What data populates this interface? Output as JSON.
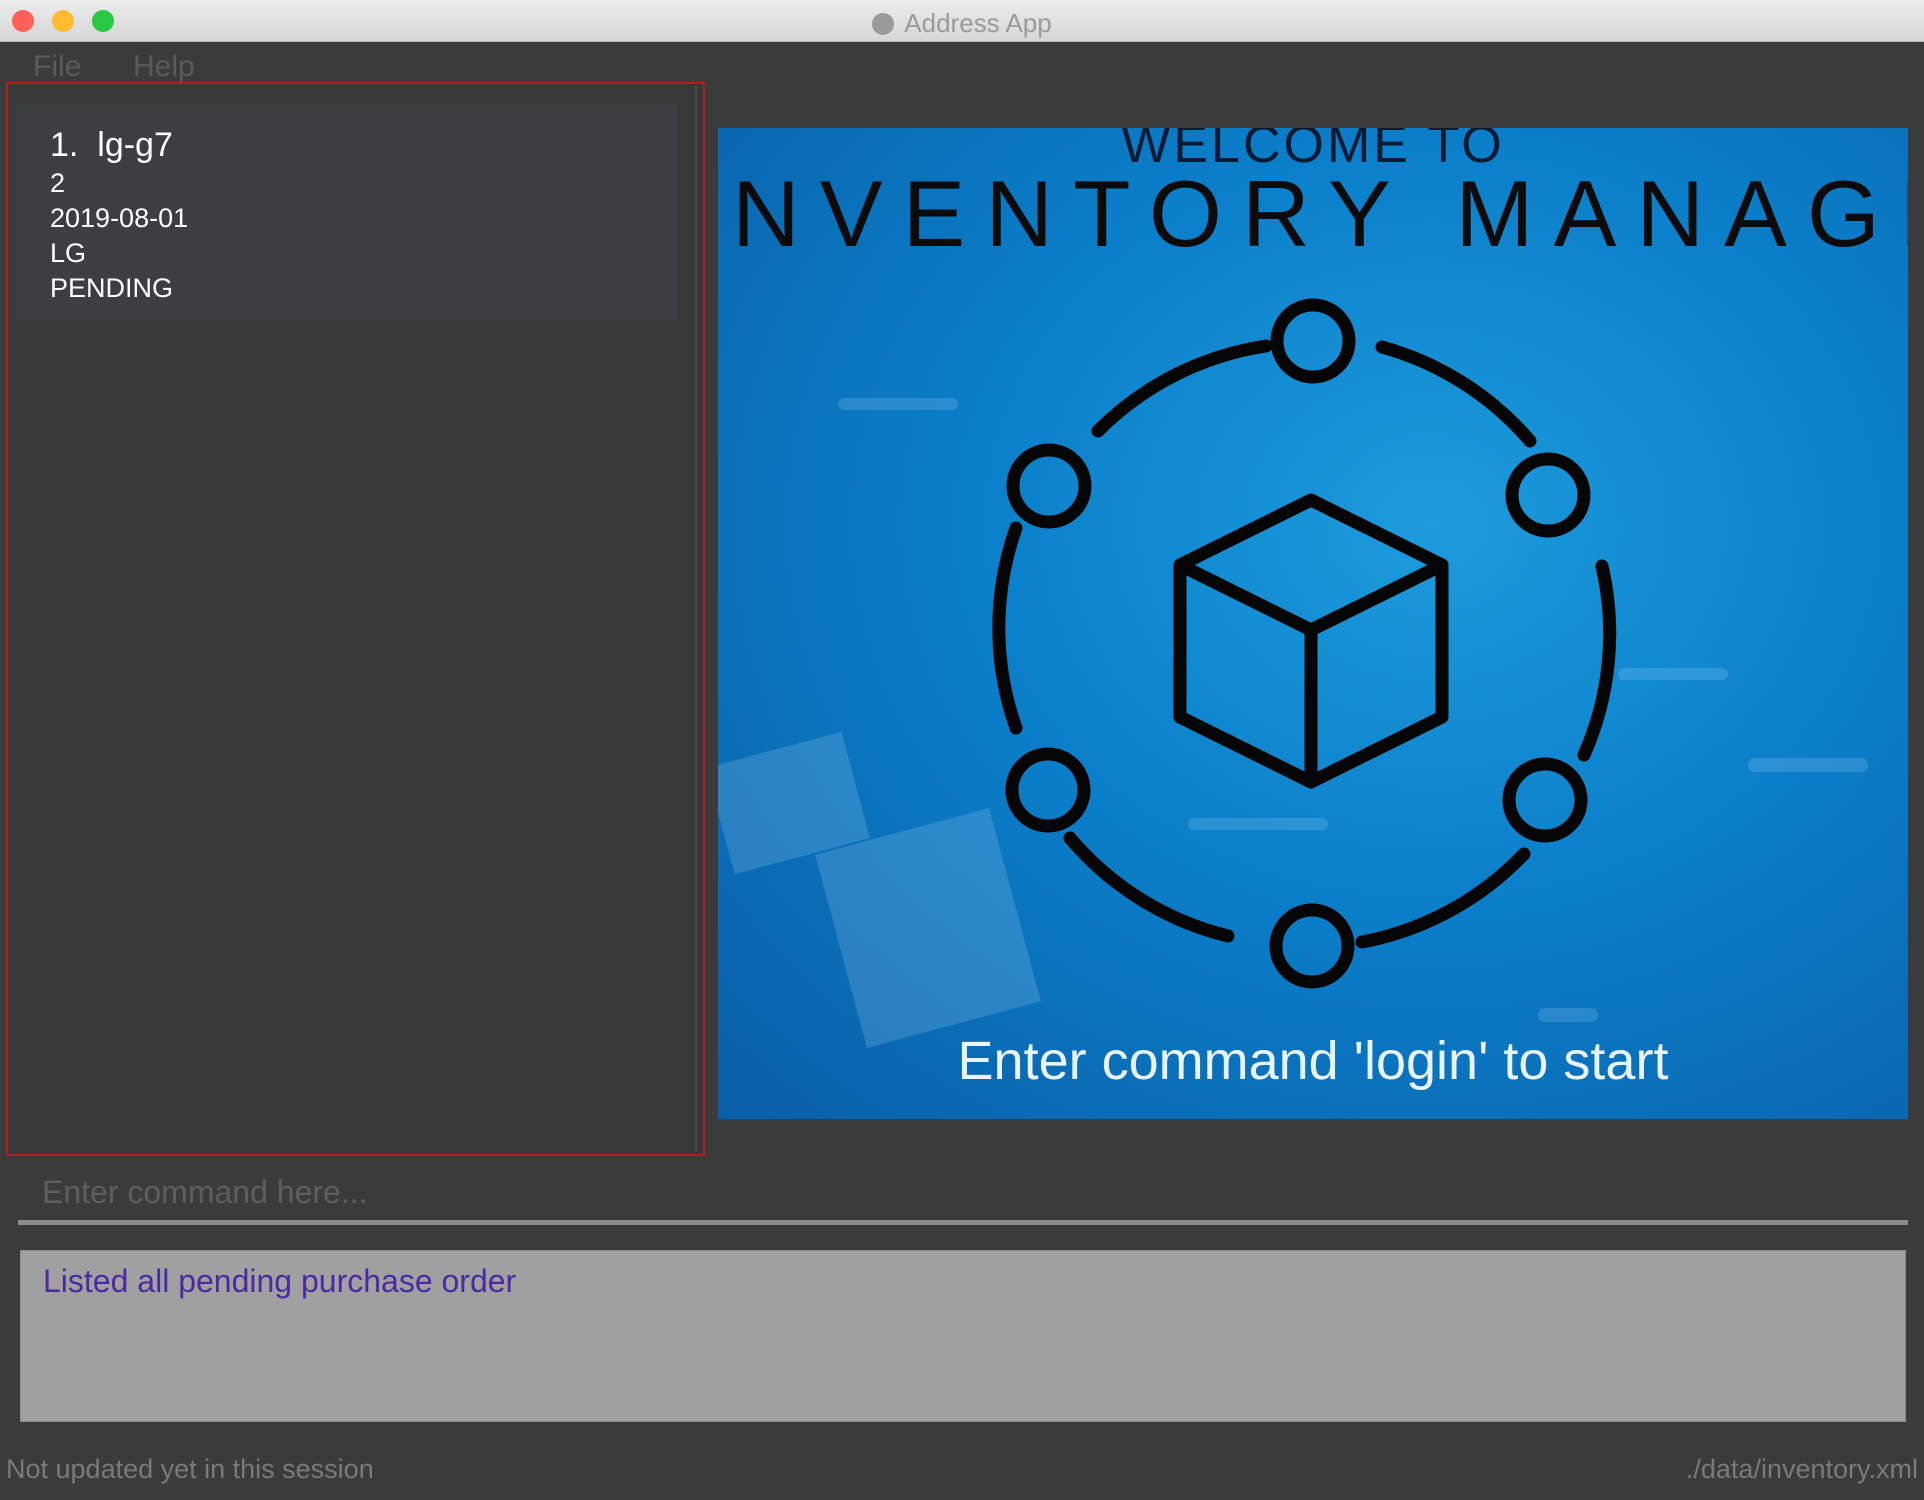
{
  "window": {
    "title": "Address App"
  },
  "menu": {
    "items": [
      "File",
      "Help"
    ]
  },
  "list": {
    "items": [
      {
        "index": "1.",
        "name": "lg-g7",
        "quantity": "2",
        "date": "2019-08-01",
        "supplier": "LG",
        "status": "PENDING"
      }
    ]
  },
  "welcome": {
    "line1": "WELCOME TO",
    "line2": "NVENTORY MANAGER",
    "instruction": "Enter command 'login' to start"
  },
  "command": {
    "placeholder": "Enter command here...",
    "value": ""
  },
  "result": {
    "message": "Listed all pending purchase order"
  },
  "status": {
    "left": "Not updated yet in this session",
    "right": "./data/inventory.xml"
  },
  "colors": {
    "accent_border": "#b01e1e",
    "result_text": "#4a2aa0",
    "welcome_bg": "#0b7fca"
  }
}
